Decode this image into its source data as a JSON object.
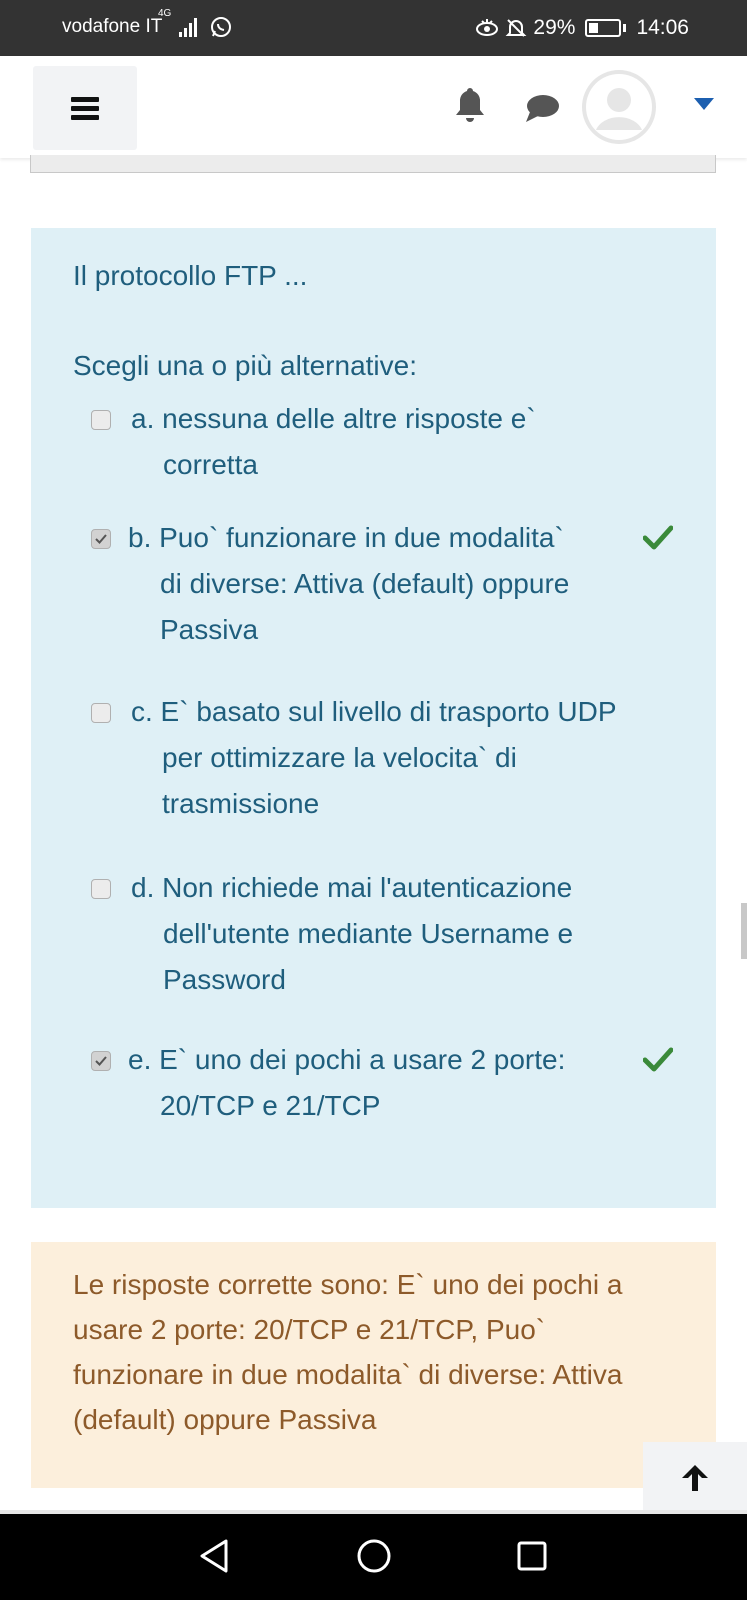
{
  "status_bar": {
    "carrier": "vodafone IT",
    "network": "4G",
    "battery_text": "29%",
    "battery_level": 0.29,
    "time": "14:06",
    "icons": [
      "signal-icon",
      "whatsapp-icon",
      "eye-icon",
      "mute-icon",
      "battery-icon"
    ]
  },
  "header": {
    "icons": [
      "menu-icon",
      "bell-icon",
      "chat-icon",
      "avatar",
      "caret-down-icon"
    ]
  },
  "question": {
    "text": "Il protocollo FTP ...",
    "prompt": "Scegli una o più alternative:",
    "answers": [
      {
        "line1": "a. nessuna delle altre risposte e`",
        "rest": "corretta",
        "checked": false,
        "correct": false
      },
      {
        "line1": "b. Puo` funzionare in due modalita`",
        "rest": "di diverse: Attiva (default)  oppure\nPassiva",
        "checked": true,
        "correct": true
      },
      {
        "line1": "c. E` basato sul livello di trasporto UDP",
        "rest": "per ottimizzare la velocita` di\ntrasmissione",
        "checked": false,
        "correct": false
      },
      {
        "line1": "d. Non richiede mai l'autenticazione",
        "rest": "dell'utente mediante Username e\nPassword",
        "checked": false,
        "correct": false
      },
      {
        "line1": "e. E` uno dei pochi a usare 2 porte:",
        "rest": "20/TCP e 21/TCP",
        "checked": true,
        "correct": true
      }
    ]
  },
  "feedback": {
    "text": "Le risposte corrette sono: E` uno dei pochi a usare 2 porte: 20/TCP e 21/TCP, Puo` funzionare in due modalita` di diverse: Attiva (default)  oppure Passiva"
  },
  "colors": {
    "question_bg": "#dff0f6",
    "question_text": "#1f5e7d",
    "feedback_bg": "#fcefdc",
    "feedback_text": "#8d5a2a",
    "correct_tick": "#3a8a3a",
    "caret": "#1c5fb0"
  },
  "nav_bar": {
    "icons": [
      "back-icon",
      "home-icon",
      "recent-apps-icon"
    ]
  }
}
